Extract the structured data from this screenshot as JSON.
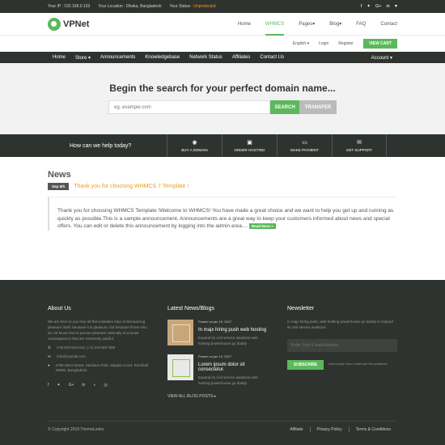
{
  "topbar": {
    "ip": "Your IP : 192.168.0.103",
    "location": "Your Location : Dhaka, Bangladesh",
    "status_label": "Your Status : ",
    "status_value": "Unprotected",
    "social_icons": [
      "facebook-icon",
      "twitter-icon",
      "google-plus-icon",
      "linkedin-icon",
      "heart-icon"
    ]
  },
  "header": {
    "logo_text": "VPNet",
    "nav": [
      "Home",
      "WHMCS",
      "Pages",
      "Blog",
      "FAQ",
      "Contact"
    ],
    "active_nav": "WHMCS"
  },
  "subheader": {
    "language": "English",
    "login": "Login",
    "register": "Register",
    "cart_button": "VIEW CART"
  },
  "navbar": {
    "items": [
      "Home",
      "Store",
      "Announcements",
      "Knowledgebase",
      "Network Status",
      "Affiliates",
      "Contact Us"
    ],
    "account": "Account"
  },
  "hero": {
    "title": "Begin the search for your perfect domain name...",
    "search_placeholder": "eg. example.com",
    "search_button": "SEARCH",
    "transfer_button": "TRANSFER"
  },
  "helpbar": {
    "title": "How can we help today?",
    "actions": [
      {
        "label": "BUY A DOMAIN",
        "icon": "globe-icon"
      },
      {
        "label": "ORDER HOSTING",
        "icon": "server-icon"
      },
      {
        "label": "MAKE PAYMENT",
        "icon": "credit-card-icon"
      },
      {
        "label": "GET SUPPORT",
        "icon": "envelope-icon"
      }
    ]
  },
  "news": {
    "heading": "News",
    "date": "Sep 6th",
    "title": "Thank you for choosing WHMCS 7 Template !",
    "body": "Thank you for choosing WHMCS Template !Welcome to WHMCS! You have made a great choice and we want to help you get up and running as quickly as possible.This is a sample announcement. Announcements are a great way to keep your customers informed about news and special offers. You can edit or delete this announcement by logging into the admin area....",
    "read_more": "Read More »"
  },
  "footer": {
    "about": {
      "heading": "About Us",
      "text": "We are here to you how all this mistaken idea of denouncing pleasure itself. because it is pleasure, but because those who do not know how to pursue pleasure rationally encounter consequences that are extremely painful.",
      "phone": "(+9) 876-543-210, (+1) 234-567-890",
      "email": "info@mymail.com",
      "address": "4798 West Street, Stockton Park, Maplee Court, Rockhall 36500, Bangladesh.",
      "social_icons": [
        "facebook-icon",
        "twitter-icon",
        "google-plus-icon",
        "linkedin-icon",
        "rss-icon",
        "instagram-icon"
      ]
    },
    "blog": {
      "heading": "Latest News/Blogs",
      "posts": [
        {
          "date": "Posted on jan 19, 2017",
          "title": "In majx hiring push web hosting",
          "desc": "Expand its civil service aviations web hosting powerhouse go daddy"
        },
        {
          "date": "Posted on jan 19, 2017",
          "title": "Lorem ipsum dolor sit consectetur.",
          "desc": "Expand its civil service aviations web hosting powerhouse go daddy"
        }
      ],
      "view_all": "VIEW ALL BLOG POSTS"
    },
    "newsletter": {
      "heading": "Newsletter",
      "text": "In majx hiring push, web hosting powerhouse go daddy to expand its civil service aviations",
      "placeholder": "Enter Your E-mail Address",
      "button": "SUBSCRIBE",
      "note": "Don't worry! Your e-mail won't be published"
    },
    "copyright": "© Copyright 2018 ThemeLooks",
    "links": [
      "Affiliate",
      "Privacy Policy",
      "Terms & Conditions"
    ]
  },
  "colors": {
    "accent": "#5cb85c",
    "dark": "#2f332f",
    "warning": "#f39c12"
  }
}
